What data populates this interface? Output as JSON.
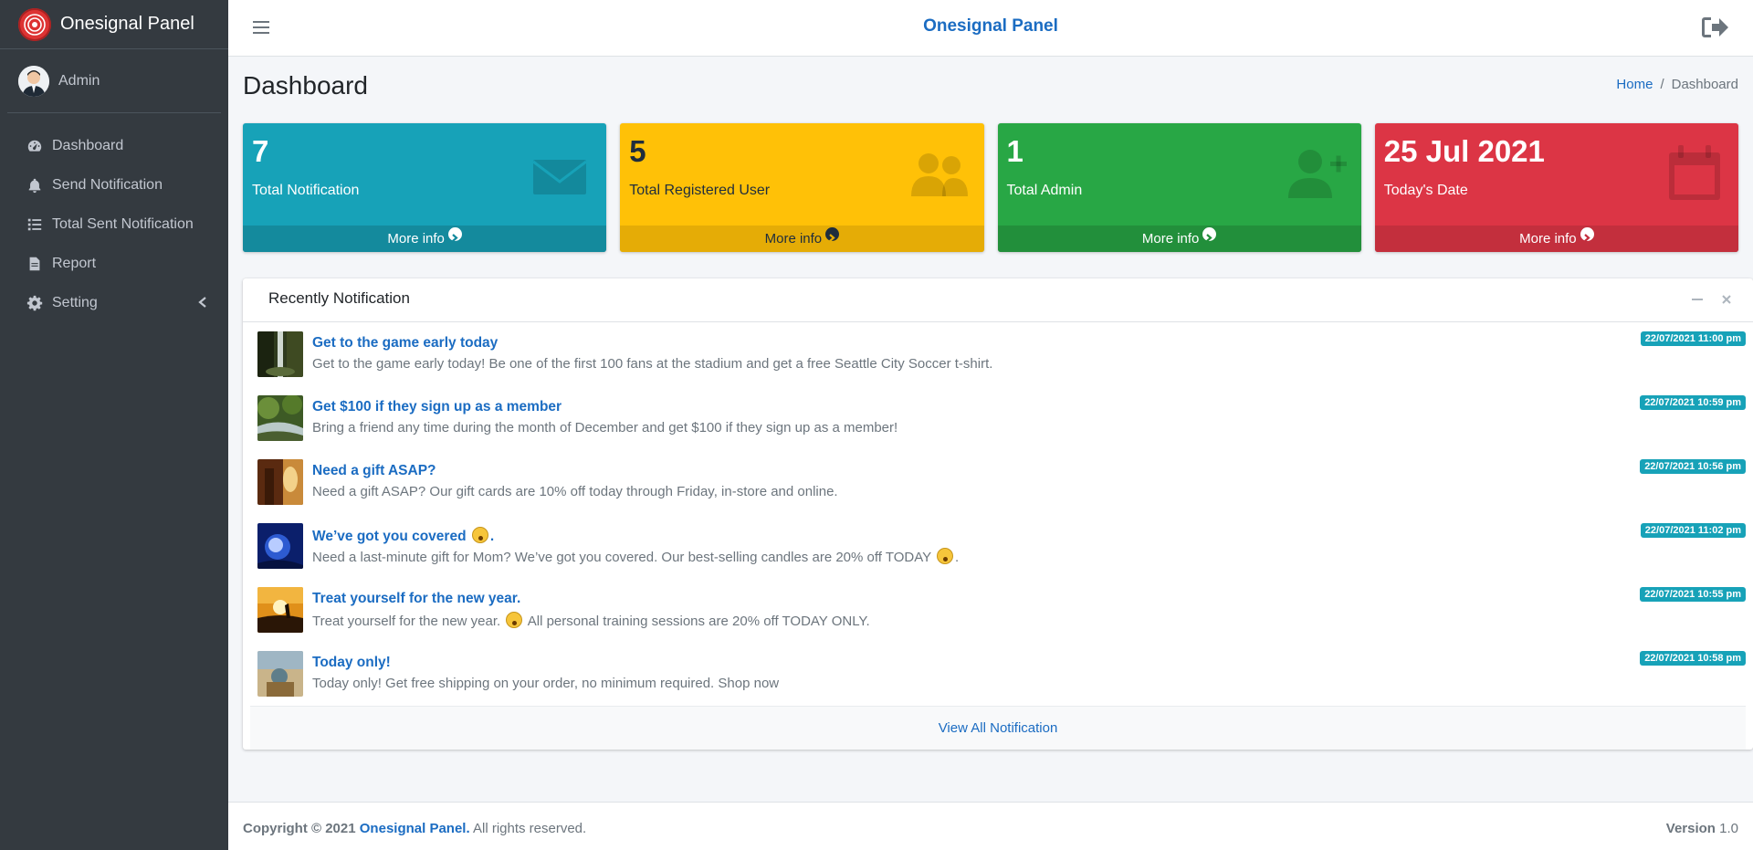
{
  "brand": {
    "name": "Onesignal Panel",
    "logo_icon": "signal-logo-icon"
  },
  "user": {
    "name": "Admin"
  },
  "sidebar": {
    "items": [
      {
        "label": "Dashboard",
        "icon": "tachometer-icon"
      },
      {
        "label": "Send Notification",
        "icon": "bell-icon"
      },
      {
        "label": "Total Sent Notification",
        "icon": "list-icon"
      },
      {
        "label": "Report",
        "icon": "file-icon"
      },
      {
        "label": "Setting",
        "icon": "gear-icon"
      }
    ]
  },
  "topbar": {
    "title": "Onesignal Panel"
  },
  "page": {
    "title": "Dashboard"
  },
  "breadcrumb": {
    "home": "Home",
    "current": "Dashboard"
  },
  "boxes": [
    {
      "value": "7",
      "label": "Total Notification",
      "more": "More info",
      "icon": "envelope-icon",
      "color": "#17a2b8"
    },
    {
      "value": "5",
      "label": "Total Registered User",
      "more": "More info",
      "icon": "users-icon",
      "color": "#ffc107"
    },
    {
      "value": "1",
      "label": "Total Admin",
      "more": "More info",
      "icon": "user-plus-icon",
      "color": "#28a745"
    },
    {
      "value": "25 Jul 2021",
      "label": "Today's Date",
      "more": "More info",
      "icon": "calendar-icon",
      "color": "#dc3545"
    }
  ],
  "recent": {
    "title": "Recently Notification",
    "items": [
      {
        "title": "Get to the game early today",
        "title_suffix": "",
        "desc": "Get to the game early today! Be one of the first 100 fans at the stadium and get a free Seattle City Soccer t-shirt.",
        "desc_suffix": "",
        "date": "22/07/2021 11:00 pm"
      },
      {
        "title": "Get $100 if they sign up as a member",
        "title_suffix": "",
        "desc": "Bring a friend any time during the month of December and get $100 if they sign up as a member!",
        "desc_suffix": "",
        "date": "22/07/2021 10:59 pm"
      },
      {
        "title": "Need a gift ASAP?",
        "title_suffix": "",
        "desc": "Need a gift ASAP? Our gift cards are 10% off today through Friday, in-store and online.",
        "desc_suffix": "",
        "date": "22/07/2021 10:56 pm"
      },
      {
        "title": "We’ve got you covered",
        "title_suffix": ".",
        "desc": "Need a last-minute gift for Mom? We’ve got you covered. Our best-selling candles are 20% off TODAY",
        "desc_suffix": ".",
        "date": "22/07/2021 11:02 pm"
      },
      {
        "title": "Treat yourself for the new year.",
        "title_suffix": "",
        "desc": "Treat yourself for the new year.",
        "desc_suffix": "All personal training sessions are 20% off TODAY ONLY.",
        "date": "22/07/2021 10:55 pm"
      },
      {
        "title": "Today only!",
        "title_suffix": "",
        "desc": "Today only! Get free shipping on your order, no minimum required. Shop now",
        "desc_suffix": "",
        "date": "22/07/2021 10:58 pm"
      }
    ],
    "view_all": "View All Notification"
  },
  "footer": {
    "copyright_prefix": "Copyright © 2021",
    "brand": "Onesignal Panel.",
    "rights": "All rights reserved.",
    "version_label": "Version",
    "version_value": "1.0"
  }
}
